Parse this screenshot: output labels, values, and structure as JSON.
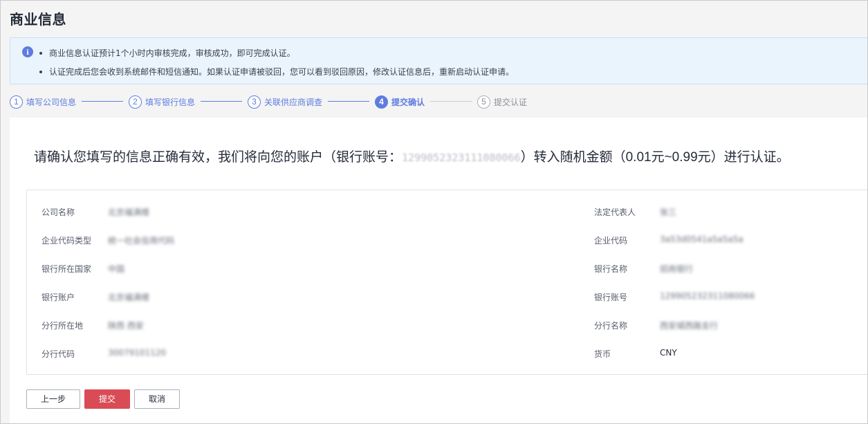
{
  "page": {
    "title": "商业信息"
  },
  "notice": {
    "icon": "info-icon",
    "lines": [
      "商业信息认证预计1个小时内审核完成，审核成功，即可完成认证。",
      "认证完成后您会收到系统邮件和短信通知。如果认证申请被驳回，您可以看到驳回原因，修改认证信息后，重新启动认证申请。"
    ]
  },
  "steps": [
    {
      "num": "1",
      "label": "填写公司信息"
    },
    {
      "num": "2",
      "label": "填写银行信息"
    },
    {
      "num": "3",
      "label": "关联供应商调查"
    },
    {
      "num": "4",
      "label": "提交确认"
    },
    {
      "num": "5",
      "label": "提交认证"
    }
  ],
  "confirm": {
    "prefix": "请确认您填写的信息正确有效，我们将向您的账户（银行账号：",
    "account": "1299052323111080066",
    "suffix": "）转入随机金额（0.01元~0.99元）进行认证。"
  },
  "fields": {
    "left": [
      {
        "label": "公司名称",
        "value": "北京福满楼"
      },
      {
        "label": "企业代码类型",
        "value": "统一社会信用代码"
      },
      {
        "label": "银行所在国家",
        "value": "中国"
      },
      {
        "label": "银行账户",
        "value": "北京福满楼"
      },
      {
        "label": "分行所在地",
        "value": "陕西 西安"
      },
      {
        "label": "分行代码",
        "value": "30079101120"
      }
    ],
    "right": [
      {
        "label": "法定代表人",
        "value": "张三"
      },
      {
        "label": "企业代码",
        "value": "3a53d0541a5a5a5a"
      },
      {
        "label": "银行名称",
        "value": "招商银行"
      },
      {
        "label": "银行账号",
        "value": "129905232311080066"
      },
      {
        "label": "分行名称",
        "value": "西安城西路支行"
      },
      {
        "label": "货币",
        "value": "CNY"
      }
    ]
  },
  "buttons": {
    "prev": "上一步",
    "submit": "提交",
    "cancel": "取消"
  },
  "colors": {
    "accent": "#5e7ce0",
    "primary_button": "#d94c56",
    "notice_bg": "#eaf4fd"
  }
}
